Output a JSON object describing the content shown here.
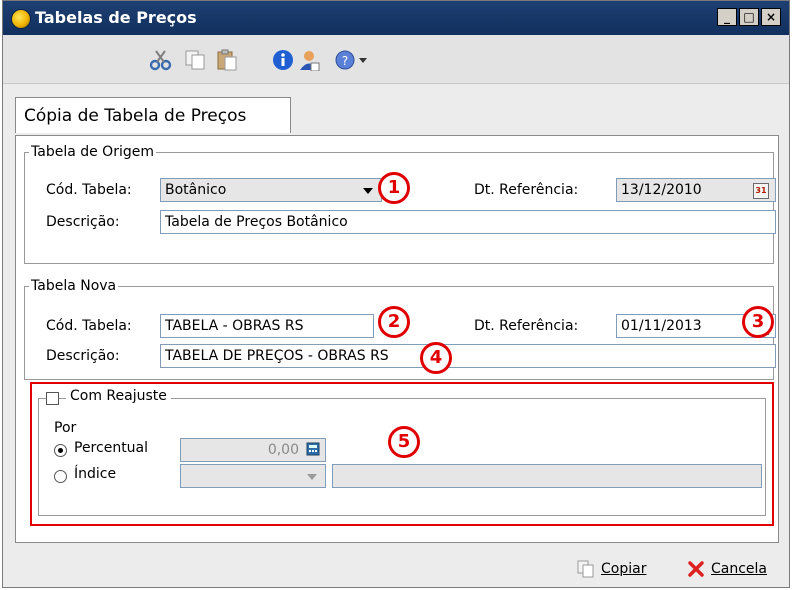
{
  "window": {
    "title": "Tabelas de Preços"
  },
  "toolbar": {
    "icons": [
      "scissors-icon",
      "copy-icon",
      "paste-icon",
      "info-icon",
      "user-icon",
      "help-icon",
      "dropdown-arrow-icon"
    ]
  },
  "tab": {
    "label": "Cópia de Tabela de Preços"
  },
  "origem": {
    "legend": "Tabela de Origem",
    "cod_label": "Cód. Tabela:",
    "cod_value": "Botânico",
    "dt_label": "Dt. Referência:",
    "dt_value": "13/12/2010",
    "desc_label": "Descrição:",
    "desc_value": "Tabela de Preços Botânico"
  },
  "nova": {
    "legend": "Tabela Nova",
    "cod_label": "Cód. Tabela:",
    "cod_value": "TABELA - OBRAS RS",
    "dt_label": "Dt. Referência:",
    "dt_value": "01/11/2013",
    "desc_label": "Descrição:",
    "desc_value": "TABELA DE PREÇOS - OBRAS RS"
  },
  "reajuste": {
    "checkbox_label": "Com Reajuste",
    "checked": false,
    "por_label": "Por",
    "percentual_label": "Percentual",
    "percentual_value": "0,00",
    "indice_label": "Índice",
    "indice_value": "",
    "selected": "Percentual"
  },
  "callouts": [
    "1",
    "2",
    "3",
    "4",
    "5"
  ],
  "footer": {
    "copiar_label": "Copiar",
    "cancela_label": "Cancela"
  },
  "colors": {
    "titlebar": "#11305e",
    "callout": "#e00000",
    "background": "#ececec"
  }
}
